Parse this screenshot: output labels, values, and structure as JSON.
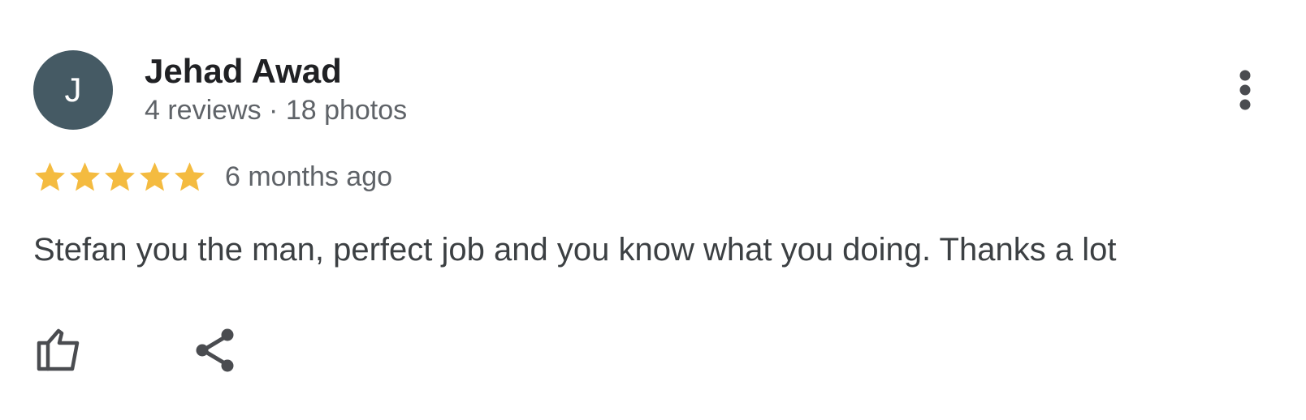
{
  "reviewer": {
    "initial": "J",
    "name": "Jehad Awad",
    "meta": "4 reviews · 18 photos",
    "avatar_color": "#455a64"
  },
  "rating": {
    "stars": 5,
    "max_stars": 5,
    "star_color": "#f4bb40",
    "date": "6 months ago"
  },
  "review": {
    "text": "Stefan you the man, perfect job and you know what you doing. Thanks a lot"
  },
  "actions": {
    "more_icon": "more-vert-icon",
    "like_icon": "thumb-up-icon",
    "share_icon": "share-icon",
    "icon_color": "#4a4c50"
  }
}
